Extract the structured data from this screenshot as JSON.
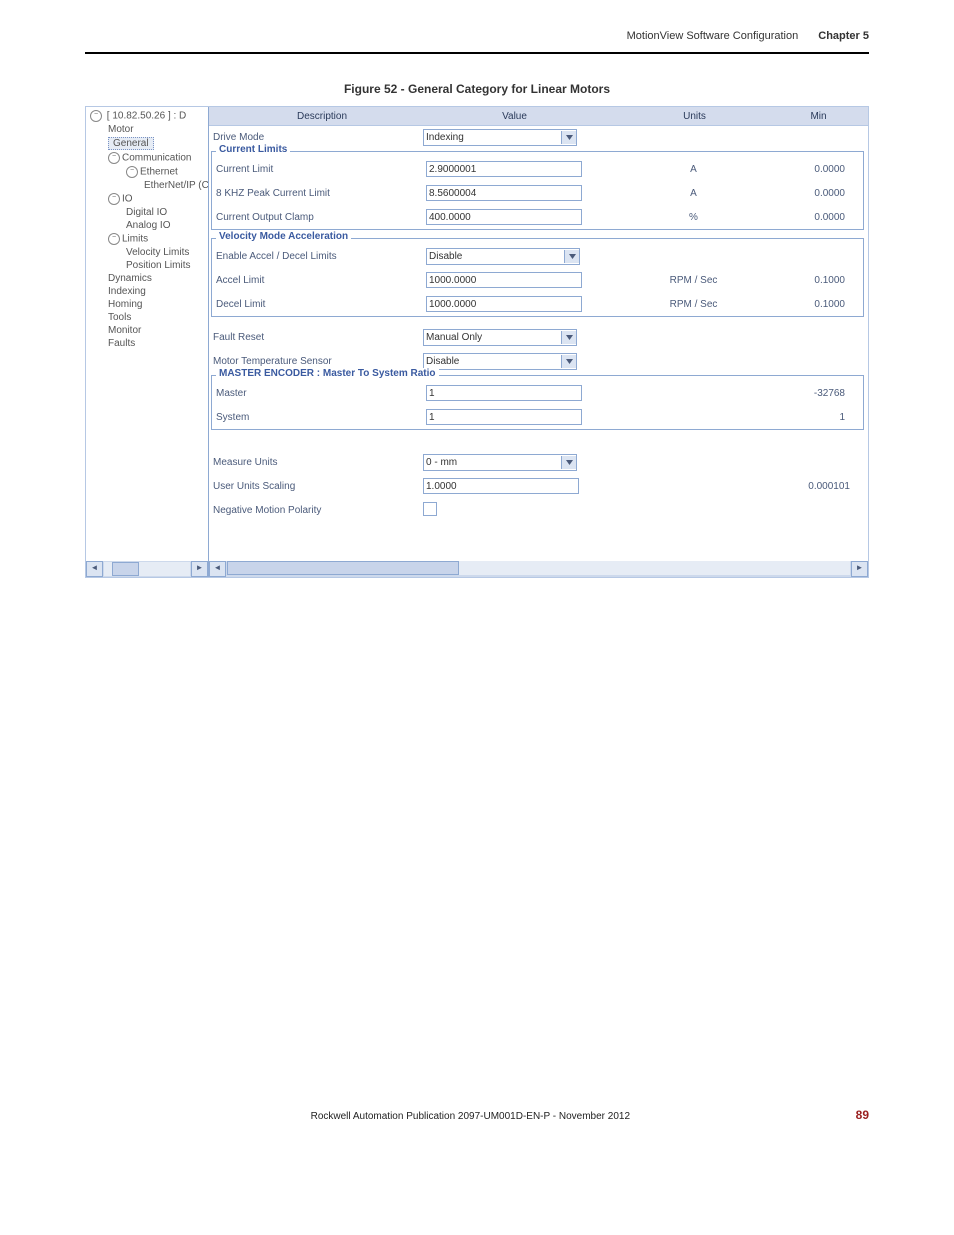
{
  "header": {
    "title": "MotionView Software Configuration",
    "chapter": "Chapter 5"
  },
  "figure_title": "Figure 52 - General Category for Linear Motors",
  "tree": {
    "root": "[ 10.82.50.26 ]   : D",
    "items": [
      {
        "label": "Motor",
        "level": 2
      },
      {
        "label": "General",
        "level": 2,
        "selected": true
      },
      {
        "label": "Communication",
        "level": 2,
        "expandable": true
      },
      {
        "label": "Ethernet",
        "level": 3,
        "expandable": true
      },
      {
        "label": "EtherNet/IP (CI",
        "level": 4
      },
      {
        "label": "IO",
        "level": 2,
        "expandable": true
      },
      {
        "label": "Digital IO",
        "level": 3
      },
      {
        "label": "Analog IO",
        "level": 3
      },
      {
        "label": "Limits",
        "level": 2,
        "expandable": true
      },
      {
        "label": "Velocity Limits",
        "level": 3
      },
      {
        "label": "Position Limits",
        "level": 3
      },
      {
        "label": "Dynamics",
        "level": 2
      },
      {
        "label": "Indexing",
        "level": 2
      },
      {
        "label": "Homing",
        "level": 2
      },
      {
        "label": "Tools",
        "level": 2
      },
      {
        "label": "Monitor",
        "level": 2
      },
      {
        "label": "Faults",
        "level": 2
      }
    ]
  },
  "columns": {
    "description": "Description",
    "value": "Value",
    "units": "Units",
    "min": "Min"
  },
  "rows": {
    "drive_mode": {
      "desc": "Drive Mode",
      "value": "Indexing"
    },
    "group_current": "Current Limits",
    "current_limit": {
      "desc": "Current Limit",
      "value": "2.9000001",
      "units": "A",
      "min": "0.0000"
    },
    "peak_current": {
      "desc": "8 KHZ Peak Current Limit",
      "value": "8.5600004",
      "units": "A",
      "min": "0.0000"
    },
    "output_clamp": {
      "desc": "Current Output Clamp",
      "value": "400.0000",
      "units": "%",
      "min": "0.0000"
    },
    "group_vel": "Velocity Mode Acceleration",
    "enable_accel": {
      "desc": "Enable Accel / Decel Limits",
      "value": "Disable"
    },
    "accel_limit": {
      "desc": "Accel Limit",
      "value": "1000.0000",
      "units": "RPM / Sec",
      "min": "0.1000"
    },
    "decel_limit": {
      "desc": "Decel Limit",
      "value": "1000.0000",
      "units": "RPM / Sec",
      "min": "0.1000"
    },
    "fault_reset": {
      "desc": "Fault Reset",
      "value": "Manual Only"
    },
    "temp_sensor": {
      "desc": "Motor Temperature Sensor",
      "value": "Disable"
    },
    "group_master": "MASTER ENCODER : Master To System Ratio",
    "master": {
      "desc": "Master",
      "value": "1",
      "min": "-32768"
    },
    "system": {
      "desc": "System",
      "value": "1",
      "min": "1"
    },
    "measure_units": {
      "desc": "Measure Units",
      "value": "0 - mm"
    },
    "user_scaling": {
      "desc": "User Units Scaling",
      "value": "1.0000",
      "min": "0.000101"
    },
    "neg_polarity": {
      "desc": "Negative Motion Polarity"
    }
  },
  "footer": {
    "publication": "Rockwell Automation Publication 2097-UM001D-EN-P - November 2012",
    "page": "89"
  },
  "chart_data": null
}
